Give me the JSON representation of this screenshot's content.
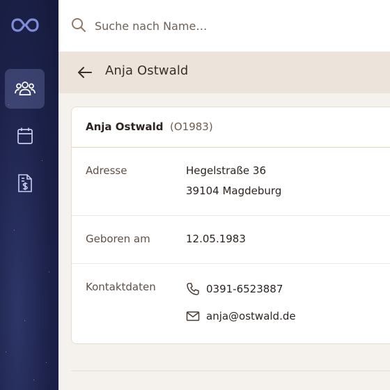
{
  "search": {
    "placeholder": "Suche nach Name…"
  },
  "header": {
    "back_icon": "arrow-left-icon",
    "title": "Anja Ostwald"
  },
  "sidebar": {
    "logo_icon": "infinity-logo",
    "items": [
      {
        "icon": "users-icon",
        "active": true
      },
      {
        "icon": "calendar-icon",
        "active": false
      },
      {
        "icon": "invoice-dollar-icon",
        "active": false
      }
    ]
  },
  "card": {
    "name": "Anja Ostwald",
    "id": "(O1983)",
    "address": {
      "label": "Adresse",
      "line1": "Hegelstraße 36",
      "line2": "39104 Magdeburg"
    },
    "birth": {
      "label": "Geboren am",
      "value": "12.05.1983"
    },
    "contact": {
      "label": "Kontaktdaten",
      "phone": "0391-6523887",
      "email": "anja@ostwald.de"
    }
  },
  "colors": {
    "sidebar": "#1c2149",
    "header": "#ece4da",
    "accent_line": "#e8d8ac"
  }
}
